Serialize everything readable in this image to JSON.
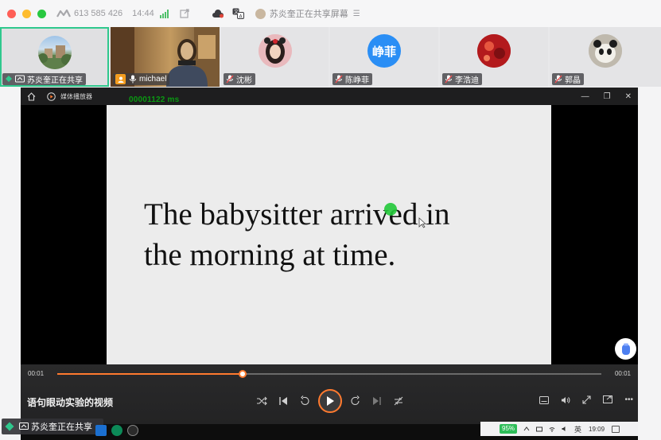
{
  "titlebar": {
    "meeting_id": "613 585 426",
    "duration": "14:44",
    "share_title": "苏炎奎正在共享屏幕",
    "menu_symbol": "☰"
  },
  "participants": [
    {
      "name": "苏炎奎正在共享",
      "active": true,
      "avatar": "landscape-photo"
    },
    {
      "name": "michael",
      "active": false,
      "avatar": "video-feed"
    },
    {
      "name": "沈彬",
      "active": false,
      "avatar": "photo"
    },
    {
      "name": "陈峥菲",
      "active": false,
      "avatar_text": "峥菲"
    },
    {
      "name": "李浩迪",
      "active": false,
      "avatar": "red-photo"
    },
    {
      "name": "郭晶",
      "active": false,
      "avatar": "panda-photo"
    }
  ],
  "player": {
    "app_name": "媒体播放器",
    "window_controls": [
      "—",
      "❐",
      "✕"
    ],
    "overlay_timer": "00001122 ms",
    "sentence_line1": "The babysitter arrived in",
    "sentence_line2": "the morning at time.",
    "time_current": "00:01",
    "time_total": "00:01",
    "progress": 0.34,
    "video_title": "语句眼动实验的视频"
  },
  "share_bar": {
    "label": "苏炎奎正在共享"
  },
  "systray": {
    "battery": "95%",
    "ime": "英",
    "clock": "19:09"
  },
  "colors": {
    "accent": "#ff7a2f",
    "active_border": "#2fc88d",
    "gaze": "#22c93a"
  }
}
